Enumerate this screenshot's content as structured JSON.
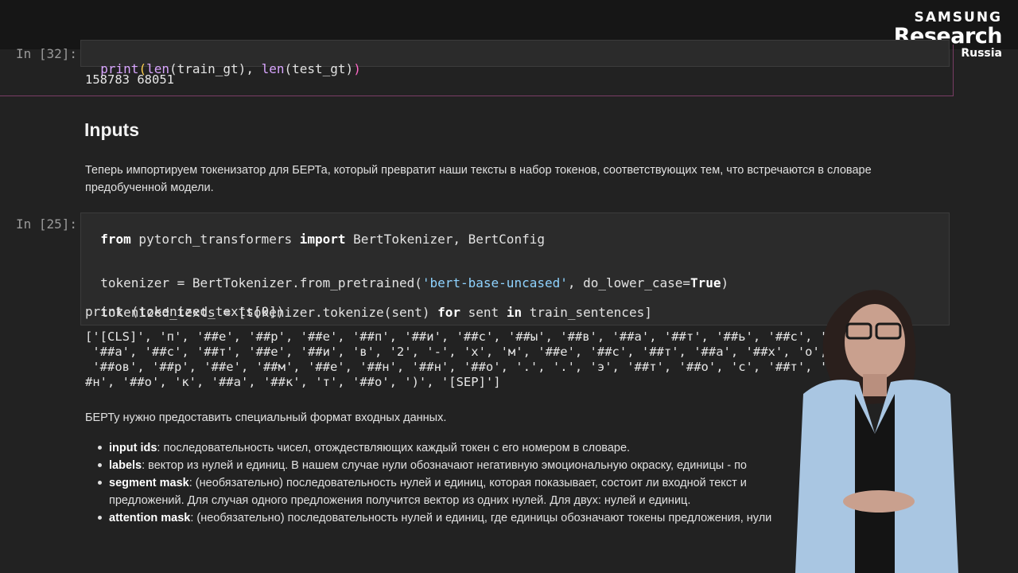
{
  "logo": {
    "line1": "SAMSUNG",
    "line2": "Research",
    "line3": "Russia"
  },
  "cell32": {
    "prompt": "In [32]:",
    "code": [
      "print",
      "(",
      "len",
      "(train_gt), ",
      "len",
      "(test_gt)",
      ")"
    ],
    "output": "158783 68051"
  },
  "heading": "Inputs",
  "paragraph1_line1": "Теперь импортируем токенизатор для БЕРТа, который превратит наши тексты в набор токенов, соответствующих тем, что встречаются в словаре",
  "paragraph1_line2": "предобученной модели.",
  "cell25": {
    "prompt": "In [25]:",
    "line1": {
      "kw1": "from",
      "mid": " pytorch_transformers ",
      "kw2": "import",
      "rest": " BertTokenizer, BertConfig"
    },
    "line2": {
      "pre": "tokenizer = BertTokenizer.from_pretrained(",
      "str": "'bert-base-uncased'",
      "mid": ", do_lower_case=",
      "kw": "True",
      "post": ")"
    },
    "line3": {
      "pre": "tokenized_texts = [tokenizer.tokenize(sent) ",
      "kw1": "for",
      "mid": " sent ",
      "kw2": "in",
      "post": " train_sentences]"
    },
    "line4": "print (tokenized_texts[0])",
    "output": [
      "['[CLS]', 'п', '##е', '##р', '##е', '##п', '##и', '##с', '##ы', '##в', '##а', '##т', '##ь', '##с', '##я', '##н",
      " '##а', '##с', '##т', '##е', '##и', 'в', '2', '-', 'х', 'м', '##е', '##с', '##т', '##а', '##х', 'о', '##",
      " '##ов', '##р', '##е', '##м', '##е', '##н', '##н', '##о', '.', '.', 'э', '##т', '##о', 'с', '##т', '##а', '#",
      "#н', '##о', 'к', '##а', '##к', 'т', '##о', ')', '[SEP]']"
    ]
  },
  "paragraph2": "БЕРТу нужно предоставить специальный формат входных данных.",
  "bullets": [
    {
      "term": "input ids",
      "text": ": последовательность чисел, отождествляющих каждый токен с его номером в словаре."
    },
    {
      "term": "labels",
      "text": ": вектор из нулей и единиц. В нашем случае нули обозначают негативную эмоциональную окраску, единицы - по"
    },
    {
      "term": "segment mask",
      "text": ": (необязательно) последовательность нулей и единиц, которая показывает, состоит ли входной текст и",
      "cont": "предложений. Для случая одного предложения получится вектор из одних нулей. Для двух: нулей и единиц."
    },
    {
      "term": "attention mask",
      "text": ": (необязательно) последовательность нулей и единиц, где единицы обозначают токены предложения, нули"
    }
  ]
}
